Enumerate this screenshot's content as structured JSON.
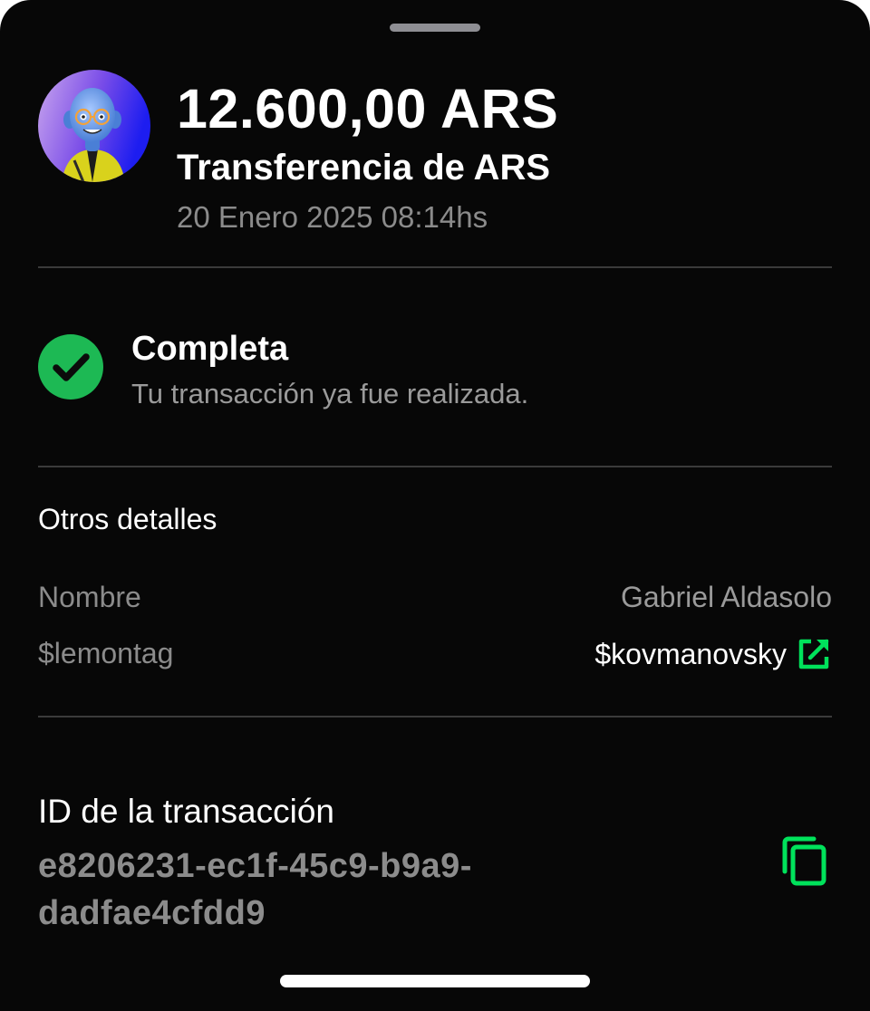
{
  "header": {
    "amount": "12.600,00 ARS",
    "type": "Transferencia de ARS",
    "date": "20 Enero 2025 08:14hs",
    "avatar_icon": "user-avatar-3d-character"
  },
  "status": {
    "icon": "check-circle-icon",
    "title": "Completa",
    "subtitle": "Tu transacción ya fue realizada.",
    "color": "#1db954"
  },
  "details": {
    "title": "Otros detalles",
    "rows": [
      {
        "label": "Nombre",
        "value": "Gabriel Aldasolo"
      },
      {
        "label": "$lemontag",
        "value": "$kovmanovsky",
        "icon": "external-link-icon"
      }
    ]
  },
  "transaction": {
    "label": "ID de la transacción",
    "id_line_1": "e8206231-ec1f-45c9-b9a9-",
    "id_line_2": "dadfae4cfdd9",
    "copy_icon": "copy-icon"
  },
  "colors": {
    "background": "#070707",
    "accent": "#00e25b",
    "muted_text": "#8b8b8b",
    "divider": "#3a3a3a"
  }
}
